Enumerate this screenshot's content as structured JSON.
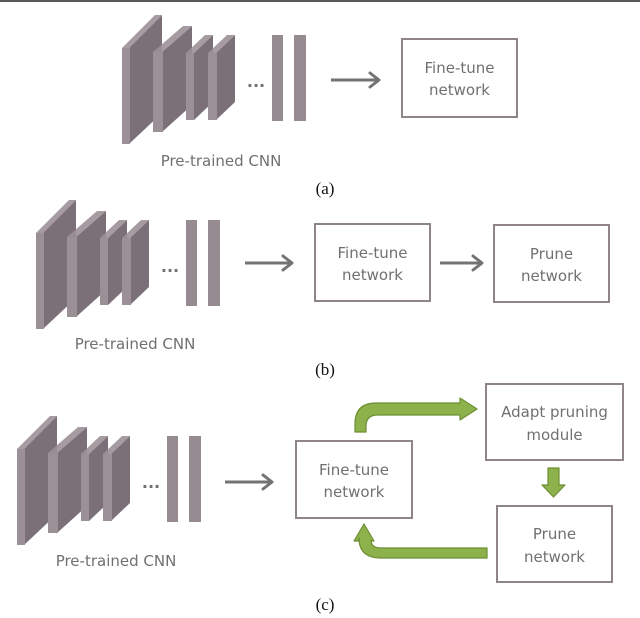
{
  "panels": [
    {
      "id": "a",
      "caption": "(a)",
      "cnn_label": "Pre-trained CNN",
      "ellipsis": "...",
      "boxes": [
        {
          "lines": [
            "Fine-tune",
            "network"
          ]
        }
      ]
    },
    {
      "id": "b",
      "caption": "(b)",
      "cnn_label": "Pre-trained CNN",
      "ellipsis": "...",
      "boxes": [
        {
          "lines": [
            "Fine-tune",
            "network"
          ]
        },
        {
          "lines": [
            "Prune",
            "network"
          ]
        }
      ]
    },
    {
      "id": "c",
      "caption": "(c)",
      "cnn_label": "Pre-trained CNN",
      "ellipsis": "...",
      "boxes": [
        {
          "lines": [
            "Fine-tune",
            "network"
          ]
        },
        {
          "lines": [
            "Adapt pruning",
            "module"
          ]
        },
        {
          "lines": [
            "Prune",
            "network"
          ]
        }
      ]
    }
  ],
  "colors": {
    "layer_front": "#9c9097",
    "layer_side": "#7b7077",
    "fc_bar": "#968b91",
    "box_border": "#8e8489",
    "text_gray": "#707070",
    "arrow_gray": "#737373",
    "loop_arrow_green": "#8db24c"
  }
}
